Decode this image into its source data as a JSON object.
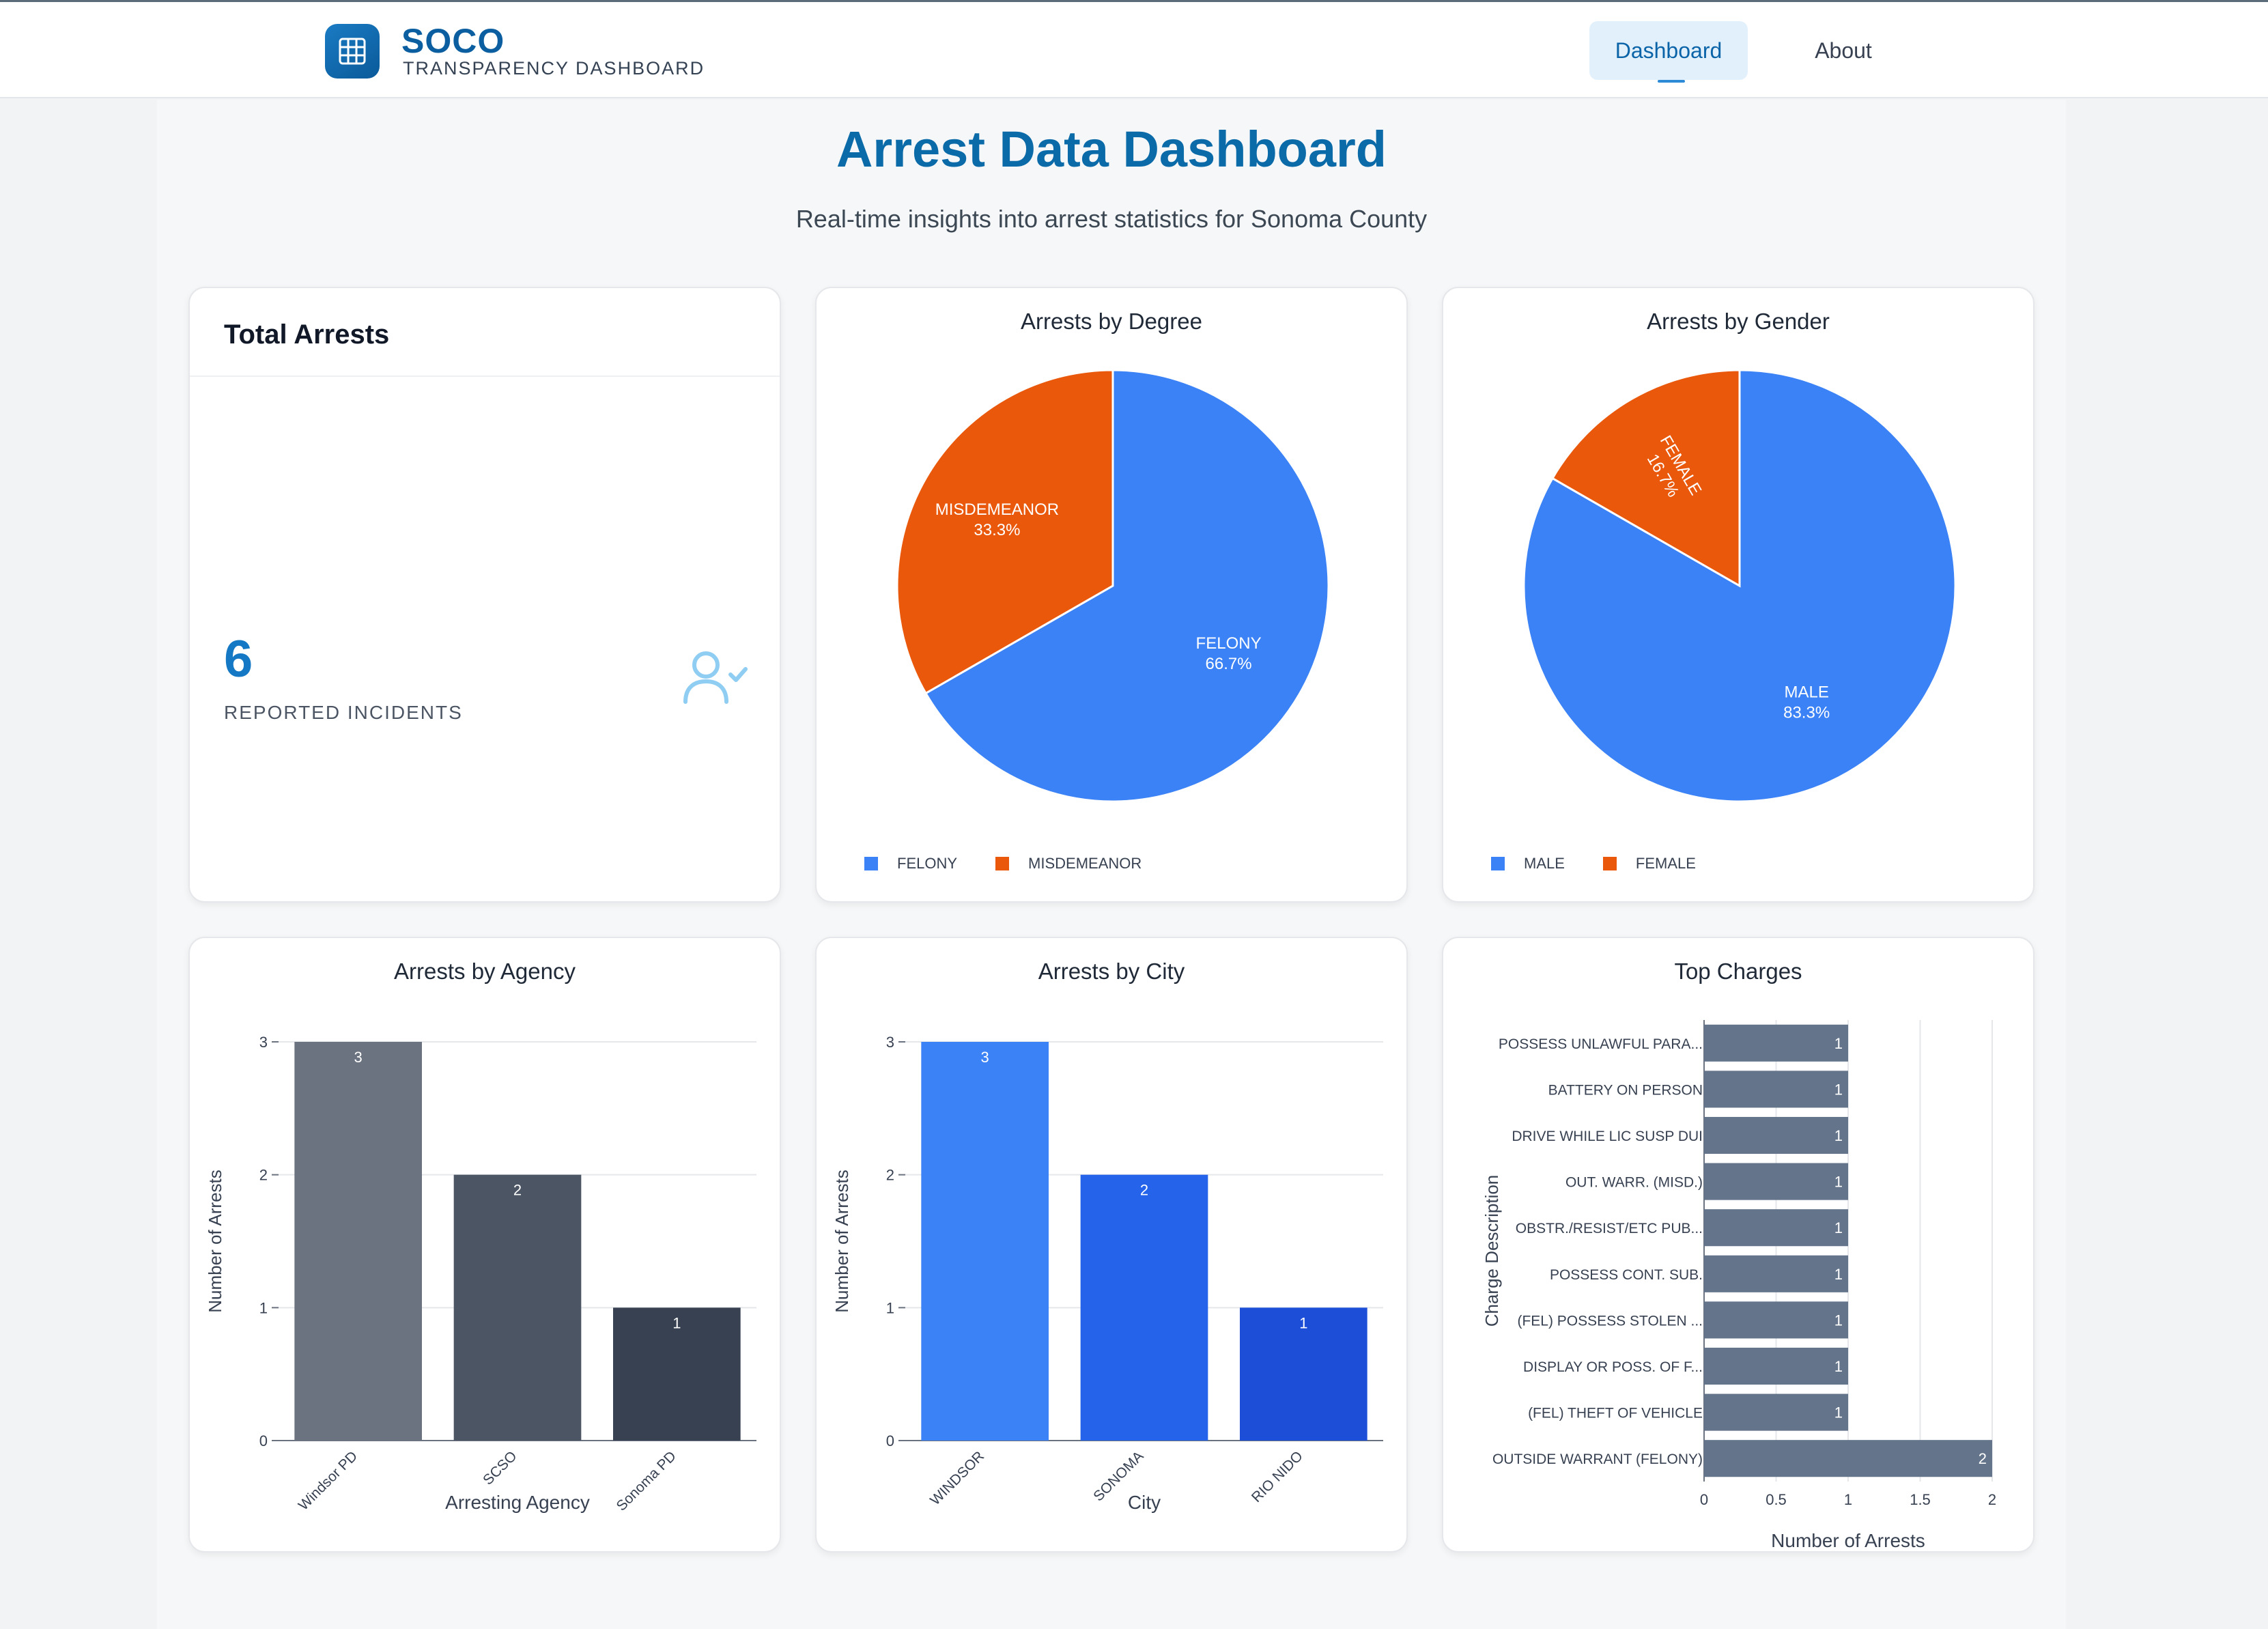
{
  "header": {
    "brand_title": "SOCO",
    "brand_subtitle": "TRANSPARENCY DASHBOARD",
    "logo_icon": "grid-icon",
    "nav": [
      {
        "label": "Dashboard",
        "active": true
      },
      {
        "label": "About",
        "active": false
      }
    ]
  },
  "page": {
    "title": "Arrest Data Dashboard",
    "subtitle": "Real-time insights into arrest statistics for Sonoma County"
  },
  "total_arrests": {
    "title": "Total Arrests",
    "value": "6",
    "label": "REPORTED INCIDENTS",
    "icon": "user-check-icon"
  },
  "colors": {
    "accent": "#0b6aa8",
    "felony": "#3b82f6",
    "misdemeanor": "#ea580c",
    "male": "#3b82f6",
    "female": "#ea580c",
    "agency_bars": [
      "#6b7280",
      "#4b5563",
      "#374151"
    ],
    "city_bars": [
      "#3b82f6",
      "#2563eb",
      "#1d4ed8"
    ],
    "charges_bar": "#64748b"
  },
  "chart_data": [
    {
      "id": "degree",
      "type": "pie",
      "title": "Arrests by Degree",
      "slices": [
        {
          "label": "FELONY",
          "value": 66.7,
          "pct_label": "66.7%"
        },
        {
          "label": "MISDEMEANOR",
          "value": 33.3,
          "pct_label": "33.3%"
        }
      ],
      "legend_position": "bottom-left"
    },
    {
      "id": "gender",
      "type": "pie",
      "title": "Arrests by Gender",
      "slices": [
        {
          "label": "MALE",
          "value": 83.3,
          "pct_label": "83.3%"
        },
        {
          "label": "FEMALE",
          "value": 16.7,
          "pct_label": "16.7%"
        }
      ],
      "legend_position": "bottom-left"
    },
    {
      "id": "agency",
      "type": "bar",
      "title": "Arrests by Agency",
      "categories": [
        "Windsor PD",
        "SCSO",
        "Sonoma PD"
      ],
      "values": [
        3,
        2,
        1
      ],
      "xlabel": "Arresting Agency",
      "ylabel": "Number of Arrests",
      "ylim": [
        0,
        3
      ],
      "yticks": [
        "0",
        "1",
        "2",
        "3"
      ],
      "grid": true
    },
    {
      "id": "city",
      "type": "bar",
      "title": "Arrests by City",
      "categories": [
        "WINDSOR",
        "SONOMA",
        "RIO NIDO"
      ],
      "values": [
        3,
        2,
        1
      ],
      "xlabel": "City",
      "ylabel": "Number of Arrests",
      "ylim": [
        0,
        3
      ],
      "yticks": [
        "0",
        "1",
        "2",
        "3"
      ],
      "grid": true
    },
    {
      "id": "charges",
      "type": "bar",
      "orientation": "horizontal",
      "title": "Top Charges",
      "categories": [
        "POSSESS UNLAWFUL PARA...",
        "BATTERY ON PERSON",
        "DRIVE WHILE LIC SUSP DUI",
        "OUT. WARR. (MISD.)",
        "OBSTR./RESIST/ETC PUB...",
        "POSSESS CONT. SUB.",
        "(FEL) POSSESS STOLEN ...",
        "DISPLAY OR POSS. OF F...",
        "(FEL)  THEFT OF VEHICLE",
        "OUTSIDE WARRANT (FELONY)"
      ],
      "values": [
        1,
        1,
        1,
        1,
        1,
        1,
        1,
        1,
        1,
        2
      ],
      "xlabel": "Number of Arrests",
      "ylabel": "Charge Description",
      "xlim": [
        0,
        2
      ],
      "xticks": [
        "0",
        "0.5",
        "1",
        "1.5",
        "2"
      ],
      "grid": true
    }
  ]
}
